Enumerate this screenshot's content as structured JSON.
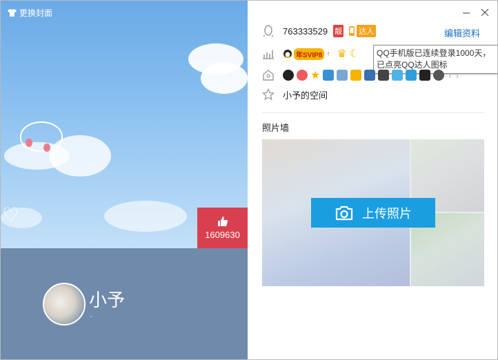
{
  "cover": {
    "change_cover_label": "更换封面",
    "like_count": "1609630"
  },
  "profile": {
    "nickname": "小予",
    "signature": "·"
  },
  "info": {
    "qq_number": "763333529",
    "liang_badge": "靓",
    "daren_badge": "达人",
    "edit_label": "编辑资料",
    "vip_label": "年SVIP8",
    "vip_arrow": "↑",
    "space_name": "小予的空间"
  },
  "tooltip": {
    "line1": "QQ手机版已连续登录1000天，",
    "line2": "已点亮QQ达人图标"
  },
  "photos": {
    "title": "照片墙",
    "upload_label": "上传照片"
  },
  "colors": {
    "like_bg": "#d9404f",
    "band_bg": "#6f8aab",
    "accent": "#1a9ee0",
    "link": "#1b6fc5"
  },
  "icons": [
    "tshirt-icon",
    "thumbs-up-icon",
    "penguin-icon",
    "level-icon",
    "crown-icon",
    "moon-icon",
    "vip-icon",
    "star-icon",
    "camera-icon",
    "mail-icon",
    "chevron-left-icon",
    "chevron-right-icon",
    "minimize-icon",
    "close-icon"
  ]
}
